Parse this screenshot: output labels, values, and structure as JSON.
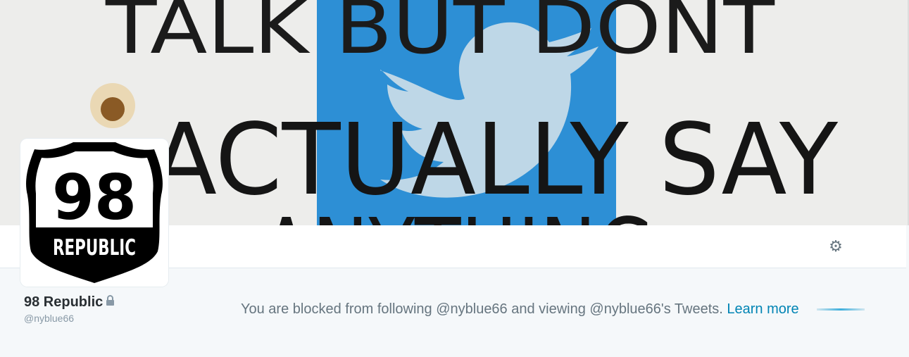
{
  "banner": {
    "line1": "TALK BUT DONT",
    "line2": "ACTUALLY SAY",
    "line3": "ANYTHING"
  },
  "avatar": {
    "shield_number": "98",
    "shield_word": "REPUBLIC"
  },
  "profile": {
    "name": "98 Republic",
    "screen_name": "@nyblue66",
    "protected_icon": "lock-icon"
  },
  "navbar": {
    "settings_icon": "gear-icon",
    "settings_glyph": "⚙"
  },
  "blocked": {
    "message": "You are blocked from following @nyblue66 and viewing @nyblue66's Tweets.",
    "learn_more": "Learn more"
  },
  "colors": {
    "page_bg": "#f5f8fa",
    "link": "#0084b4",
    "text_muted": "#66757f",
    "name": "#292f33",
    "twitter_blue": "#2d8fd5"
  }
}
